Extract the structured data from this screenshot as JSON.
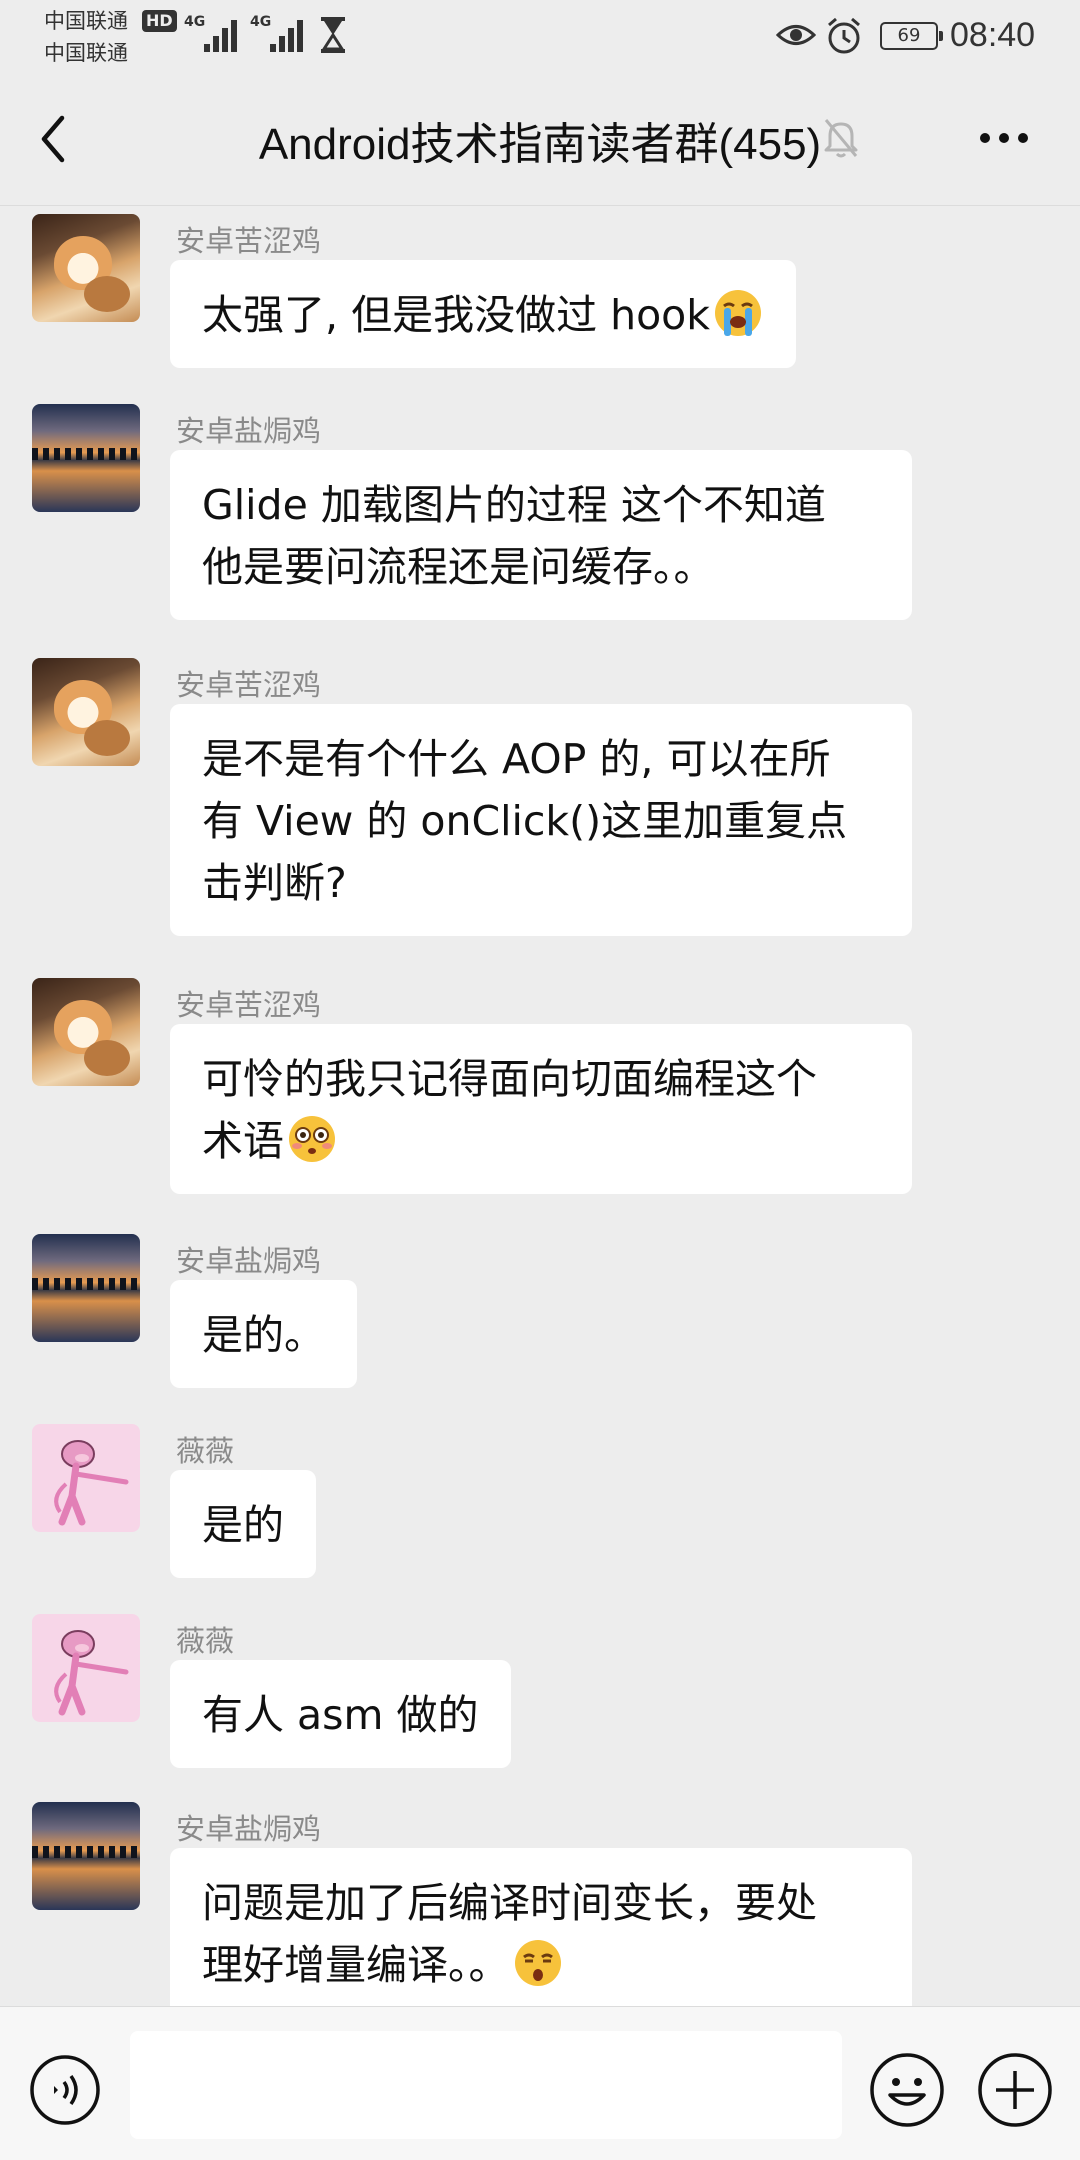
{
  "status_bar": {
    "carrier_1": "中国联通",
    "carrier_2": "中国联通",
    "hd_badge": "HD",
    "network_1": "4G",
    "network_2": "4G",
    "battery": "69",
    "time": "08:40"
  },
  "header": {
    "title": "Android技术指南读者群(455)",
    "back_icon": "chevron-left-icon",
    "mute_icon": "bell-off-icon",
    "more_icon": "more-horizontal-icon"
  },
  "messages": [
    {
      "sender": "安卓苦涩鸡",
      "avatar": "shiba-dog",
      "lines": [
        "太强了, 但是我没做过 hook"
      ],
      "emoji": "loudly-crying-face"
    },
    {
      "sender": "安卓盐焗鸡",
      "avatar": "lake-sunset",
      "lines": [
        "Glide 加载图片的过程 这个不知道",
        "他是要问流程还是问缓存。。"
      ]
    },
    {
      "sender": "安卓苦涩鸡",
      "avatar": "shiba-dog",
      "lines": [
        "是不是有个什么 AOP 的, 可以在所",
        "有 View 的 onClick()这里加重复点",
        "击判断?"
      ]
    },
    {
      "sender": "安卓苦涩鸡",
      "avatar": "shiba-dog",
      "lines": [
        "可怜的我只记得面向切面编程这个",
        "术语"
      ],
      "emoji": "flushed-face"
    },
    {
      "sender": "安卓盐焗鸡",
      "avatar": "lake-sunset",
      "lines": [
        "是的。"
      ]
    },
    {
      "sender": "薇薇",
      "avatar": "pink-panther",
      "lines": [
        "是的"
      ]
    },
    {
      "sender": "薇薇",
      "avatar": "pink-panther",
      "lines": [
        "有人 asm 做的"
      ]
    },
    {
      "sender": "安卓盐焗鸡",
      "avatar": "lake-sunset",
      "lines": [
        "问题是加了后编译时间变长，要处",
        "理好增量编译。。"
      ],
      "emoji": "kissing-face"
    }
  ],
  "input_bar": {
    "voice_icon": "voice-icon",
    "input_value": "",
    "emoji_icon": "smiley-icon",
    "add_icon": "plus-circle-icon"
  },
  "colors": {
    "background": "#ededed",
    "bubble": "#ffffff",
    "sender_name": "#8a8a8a",
    "input_bar": "#f7f7f7"
  }
}
